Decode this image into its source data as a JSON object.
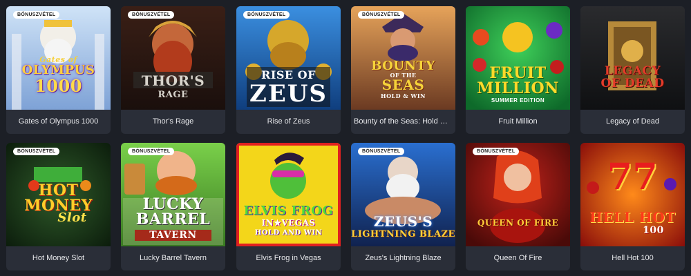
{
  "badge_label": "BÓNUSZVÉTEL",
  "games": [
    {
      "title": "Gates of Olympus 1000",
      "bonus": true,
      "logo_lines": [
        "Gates of",
        "OLYMPUS",
        "1000"
      ]
    },
    {
      "title": "Thor's Rage",
      "bonus": true,
      "logo_lines": [
        "THOR'S",
        "RAGE"
      ]
    },
    {
      "title": "Rise of Zeus",
      "bonus": true,
      "logo_lines": [
        "RISE OF",
        "ZEUS"
      ]
    },
    {
      "title": "Bounty of the Seas: Hold & W...",
      "bonus": true,
      "logo_lines": [
        "BOUNTY",
        "OF THE",
        "SEAS",
        "HOLD & WIN"
      ]
    },
    {
      "title": "Fruit Million",
      "bonus": false,
      "logo_lines": [
        "FRUIT",
        "MILLION",
        "SUMMER EDITION"
      ]
    },
    {
      "title": "Legacy of Dead",
      "bonus": false,
      "logo_lines": [
        "LEGACY",
        "OF DEAD"
      ]
    },
    {
      "title": "Hot Money Slot",
      "bonus": true,
      "logo_lines": [
        "HOT",
        "MONEY",
        "Slot"
      ]
    },
    {
      "title": "Lucky Barrel Tavern",
      "bonus": true,
      "logo_lines": [
        "LUCKY",
        "BARREL",
        "TAVERN"
      ]
    },
    {
      "title": "Elvis Frog in Vegas",
      "bonus": false,
      "logo_lines": [
        "ELVIS FROG",
        "IN★VEGAS",
        "HOLD AND WIN"
      ]
    },
    {
      "title": "Zeus's Lightning Blaze",
      "bonus": true,
      "logo_lines": [
        "ZEUS'S",
        "LIGHTNING BLAZE"
      ]
    },
    {
      "title": "Queen Of Fire",
      "bonus": true,
      "logo_lines": [
        "QUEEN OF FIRE"
      ]
    },
    {
      "title": "Hell Hot 100",
      "bonus": false,
      "logo_lines": [
        "77",
        "HELL HOT",
        "100"
      ]
    }
  ]
}
